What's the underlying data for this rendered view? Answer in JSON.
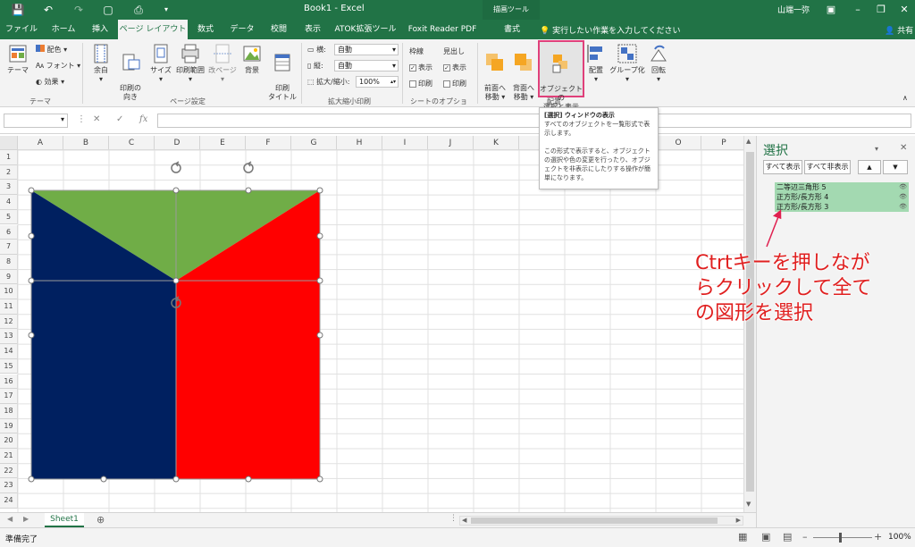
{
  "titlebar": {
    "title": "Book1 - Excel",
    "context_tab": "描画ツール",
    "user": "山端一弥",
    "tell_me": "実行したい作業を入力してください",
    "share": "共有"
  },
  "tabs": [
    "ファイル",
    "ホーム",
    "挿入",
    "ページ レイアウト",
    "数式",
    "データ",
    "校閲",
    "表示",
    "ATOK拡張ツール",
    "Foxit Reader PDF",
    "書式"
  ],
  "ribbon": {
    "theme": {
      "themes": "テーマ",
      "colors": "配色",
      "fonts": "フォント",
      "effects": "効果",
      "group": "テーマ"
    },
    "page_setup": {
      "margins": "余白",
      "orientation": "印刷の\n向き",
      "size": "サイズ",
      "print_area": "印刷範囲",
      "breaks": "改ページ",
      "background": "背景",
      "print_titles": "印刷\nタイトル",
      "group": "ページ設定"
    },
    "scale": {
      "width_label": "横:",
      "width_value": "自動",
      "height_label": "縦:",
      "height_value": "自動",
      "scale_label": "拡大/縮小:",
      "scale_value": "100%",
      "group": "拡大縮小印刷"
    },
    "sheet_options": {
      "gridlines": "枠線",
      "headings": "見出し",
      "view": "表示",
      "print": "印刷",
      "group": "シートのオプション"
    },
    "arrange": {
      "bring_forward": "前面へ\n移動",
      "send_backward": "背面へ\n移動",
      "selection_pane": "オブジェクトの\n選択と表示",
      "align": "配置",
      "group_btn": "グループ化",
      "rotate": "回転",
      "group": "配置"
    }
  },
  "formula": {
    "fx": "fx",
    "cancel": "✕",
    "enter": "✓"
  },
  "tooltip": {
    "title": "[選択] ウィンドウの表示",
    "line1": "すべてのオブジェクトを一覧形式で表示します。",
    "line2": "この形式で表示すると、オブジェクトの選択や色の変更を行ったり、オブジェクトを非表示にしたりする操作が簡単になります。"
  },
  "columns": [
    "A",
    "B",
    "C",
    "D",
    "E",
    "F",
    "G",
    "H",
    "I",
    "J",
    "K",
    "L",
    "M",
    "N",
    "O",
    "P"
  ],
  "rows": [
    "1",
    "2",
    "3",
    "4",
    "5",
    "6",
    "7",
    "8",
    "9",
    "10",
    "11",
    "12",
    "13",
    "14",
    "15",
    "16",
    "17",
    "18",
    "19",
    "20",
    "21",
    "22",
    "23",
    "24"
  ],
  "shape_colors": {
    "green": "#70ad47",
    "navy": "#002060",
    "red": "#ff0000"
  },
  "selection_pane": {
    "title": "選択",
    "show_all": "すべて表示",
    "hide_all": "すべて非表示",
    "items": [
      "二等辺三角形 5",
      "正方形/長方形 4",
      "正方形/長方形 3"
    ]
  },
  "annotation": "Ctrtキーを押しながらクリックして全ての図形を選択",
  "sheet": {
    "tab": "Sheet1"
  },
  "status": {
    "ready": "準備完了",
    "zoom": "100%"
  }
}
